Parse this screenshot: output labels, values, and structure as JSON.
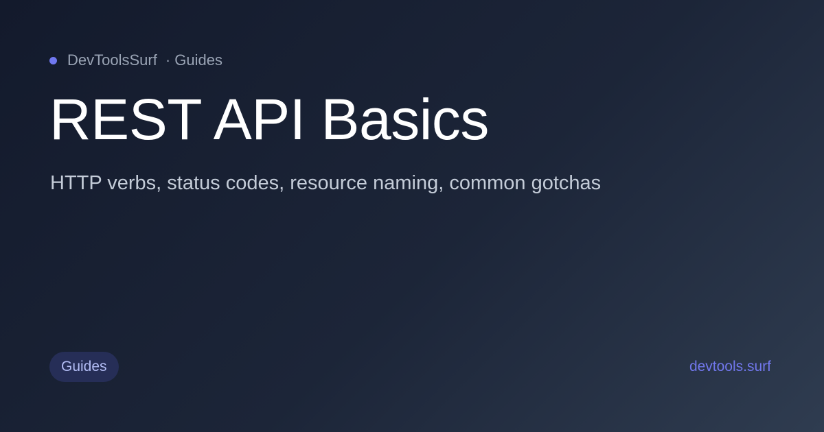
{
  "brand": {
    "name": "DevToolsSurf",
    "section": "· Guides",
    "dot_color": "#7078f0"
  },
  "title": "REST API Basics",
  "subtitle": "HTTP verbs, status codes, resource naming, common gotchas",
  "badge": {
    "label": "Guides"
  },
  "site": {
    "url_text": "devtools.surf",
    "accent_color": "#7177ec"
  }
}
